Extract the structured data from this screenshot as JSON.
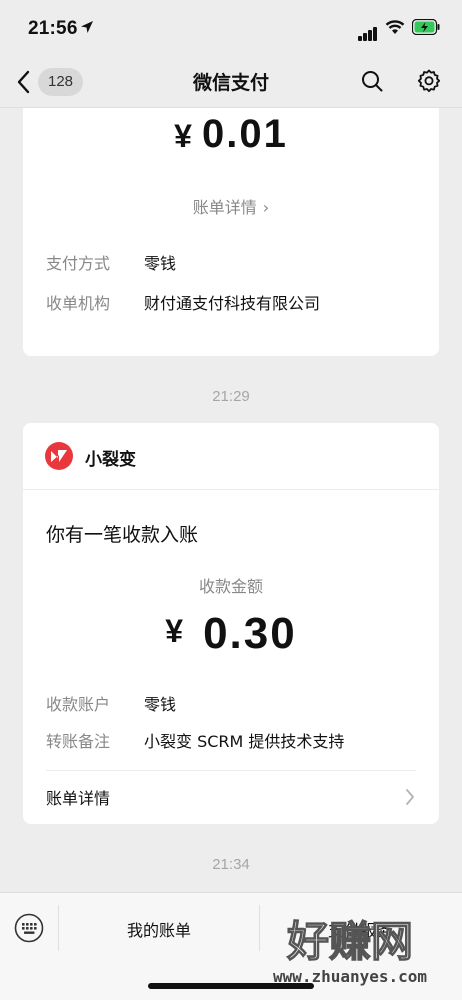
{
  "status_bar": {
    "time": "21:56",
    "icons": [
      "location-arrow-icon",
      "signal-icon",
      "wifi-icon",
      "battery-charging-icon"
    ]
  },
  "nav": {
    "back_count": "128",
    "title": "微信支付",
    "icons": [
      "back-chevron-icon",
      "search-icon",
      "gear-icon"
    ]
  },
  "card1": {
    "currency": "¥",
    "amount": "0.01",
    "details_link": "账单详情",
    "rows": [
      {
        "label": "支付方式",
        "value": "零钱"
      },
      {
        "label": "收单机构",
        "value": "财付通支付科技有限公司"
      }
    ]
  },
  "timestamp1": "21:29",
  "card2": {
    "merchant_name": "小裂变",
    "notice": "你有一笔收款入账",
    "amount_label": "收款金额",
    "currency": "¥",
    "amount": "0.30",
    "rows": [
      {
        "label": "收款账户",
        "value": "零钱"
      },
      {
        "label": "转账备注",
        "value": "小裂变 SCRM 提供技术支持"
      }
    ],
    "bill_link": "账单详情"
  },
  "timestamp2": "21:34",
  "bottom_bar": {
    "tab_account": "我的账单",
    "tab_service": "支付服务"
  },
  "watermark": {
    "text": "好赚网",
    "url": "www.zhuanyes.com"
  },
  "colors": {
    "background": "#ededed",
    "card": "#ffffff",
    "secondary_text": "#888888",
    "merchant_brand": "#e8383d",
    "battery_green": "#34c759"
  }
}
